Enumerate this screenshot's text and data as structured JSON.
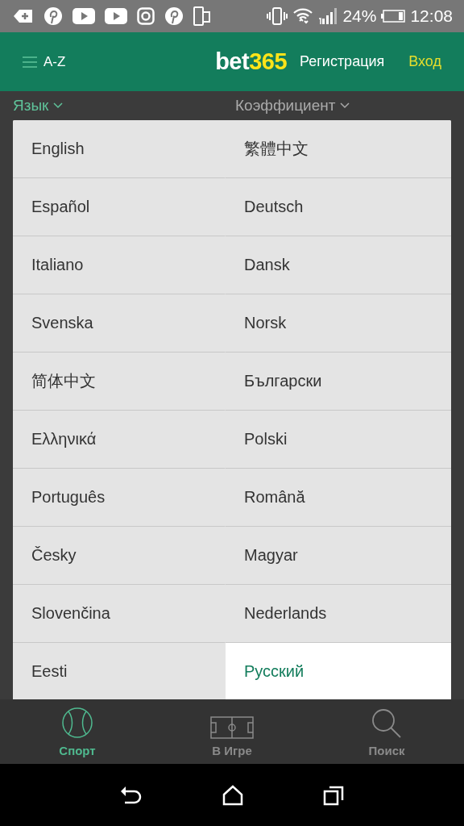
{
  "status_bar": {
    "battery": "24%",
    "time": "12:08"
  },
  "header": {
    "menu_label": "A-Z",
    "logo": [
      "bet",
      "365"
    ],
    "register": "Регистрация",
    "login": "Вход"
  },
  "filters": [
    {
      "label": "Язык",
      "selected": true
    },
    {
      "label": "Коэффициент",
      "selected": false
    }
  ],
  "languages": [
    {
      "label": "English",
      "selected": false
    },
    {
      "label": "繁體中文",
      "selected": false
    },
    {
      "label": "Español",
      "selected": false
    },
    {
      "label": "Deutsch",
      "selected": false
    },
    {
      "label": "Italiano",
      "selected": false
    },
    {
      "label": "Dansk",
      "selected": false
    },
    {
      "label": "Svenska",
      "selected": false
    },
    {
      "label": "Norsk",
      "selected": false
    },
    {
      "label": "简体中文",
      "selected": false
    },
    {
      "label": "Български",
      "selected": false
    },
    {
      "label": "Ελληνικά",
      "selected": false
    },
    {
      "label": "Polski",
      "selected": false
    },
    {
      "label": "Português",
      "selected": false
    },
    {
      "label": "Română",
      "selected": false
    },
    {
      "label": "Česky",
      "selected": false
    },
    {
      "label": "Magyar",
      "selected": false
    },
    {
      "label": "Slovenčina",
      "selected": false
    },
    {
      "label": "Nederlands",
      "selected": false
    },
    {
      "label": "Eesti",
      "selected": false
    },
    {
      "label": "Русский",
      "selected": true
    }
  ],
  "bottom_nav": [
    {
      "label": "Спорт",
      "kind": "ball",
      "selected": true
    },
    {
      "label": "В Игре",
      "kind": "field",
      "selected": false
    },
    {
      "label": "Поиск",
      "kind": "search",
      "selected": false
    }
  ]
}
